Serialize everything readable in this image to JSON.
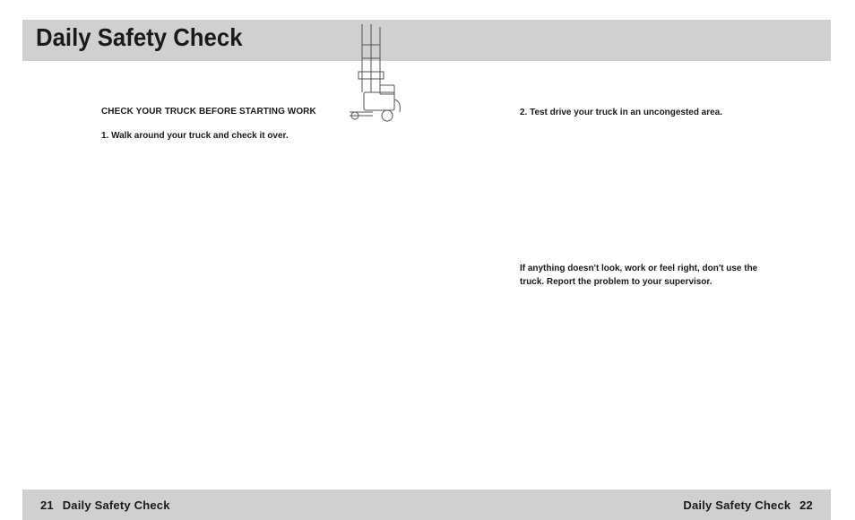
{
  "header": {
    "title": "Daily Safety Check"
  },
  "left_column": {
    "subheading": "CHECK YOUR TRUCK BEFORE STARTING WORK",
    "item1": "1.  Walk around your truck and check it over."
  },
  "right_column": {
    "item2": "2. Test drive your truck in an uncongested area.",
    "warning": "If anything doesn't look, work or feel right, don't use the truck. Report the problem to your supervisor."
  },
  "footer": {
    "left_number": "21",
    "left_label": "Daily Safety Check",
    "right_label": "Daily Safety Check",
    "right_number": "22"
  },
  "illustration": {
    "name": "forklift-stacker-icon"
  }
}
